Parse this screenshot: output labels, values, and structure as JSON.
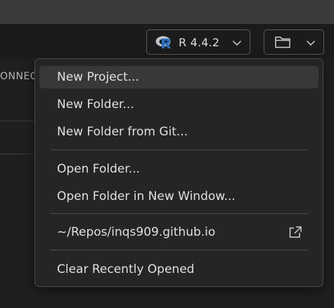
{
  "toolbar": {
    "r_version": "R 4.4.2",
    "r_icon": "r-logo-icon",
    "folder_icon": "folder-icon",
    "chevron_icon": "chevron-down-icon"
  },
  "left_pane": {
    "label": "ONNEC"
  },
  "menu": {
    "items": [
      {
        "label": "New Project..."
      },
      {
        "label": "New Folder..."
      },
      {
        "label": "New Folder from Git..."
      },
      {
        "label": "Open Folder..."
      },
      {
        "label": "Open Folder in New Window..."
      },
      {
        "label": "~/Repos/inqs909.github.io",
        "icon": "open-external-icon"
      },
      {
        "label": "Clear Recently Opened"
      }
    ]
  },
  "colors": {
    "background": "#1f1f1f",
    "menu_background": "#252525",
    "highlight": "#383838",
    "r_logo_blue": "#276dc3",
    "r_logo_gray": "#c0c0c0",
    "text": "#e0e0e0"
  }
}
